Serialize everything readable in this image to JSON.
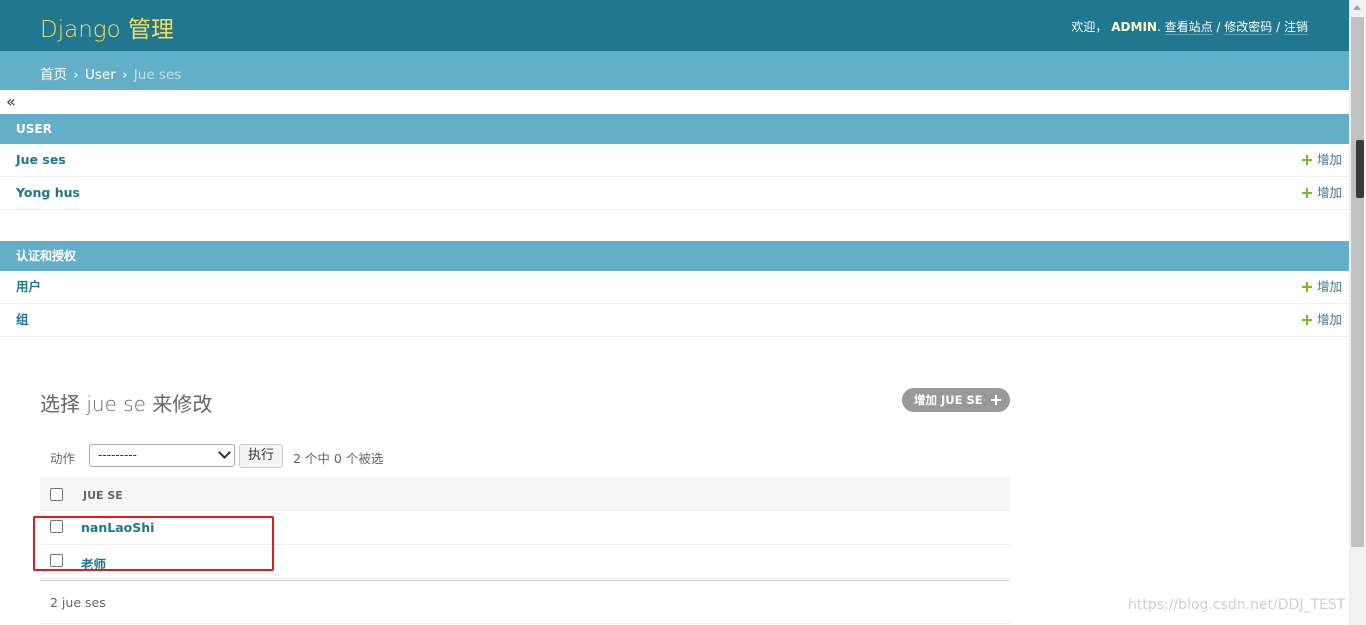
{
  "header": {
    "brand": "Django 管理",
    "welcome": "欢迎，",
    "username": "ADMIN",
    "view_site": "查看站点",
    "change_password": "修改密码",
    "logout": "注销",
    "sep": " / "
  },
  "breadcrumbs": {
    "home": "首页",
    "app": "User",
    "current": "Jue ses",
    "sep": "›"
  },
  "sidebar_toggle": "«",
  "apps": [
    {
      "caption": "USER",
      "models": [
        {
          "name": "Jue ses",
          "add": "增加"
        },
        {
          "name": "Yong hus",
          "add": "增加"
        }
      ]
    },
    {
      "caption": "认证和授权",
      "models": [
        {
          "name": "用户",
          "add": "增加"
        },
        {
          "name": "组",
          "add": "增加"
        }
      ]
    }
  ],
  "content": {
    "title": "选择 jue se 来修改",
    "add_button": "增加 JUE SE",
    "actions_label": "动作",
    "action_selected": "---------",
    "go_button": "执行",
    "counter": "2 个中 0 个被选",
    "column_header": "JUE SE",
    "rows": [
      "nanLaoShi",
      "老师"
    ],
    "paginator": "2 jue ses"
  },
  "watermark": "https://blog.csdn.net/DDJ_TEST",
  "colors": {
    "header_bg": "#217690",
    "brand": "#f5dd5d",
    "breadcrumbs_bg": "#63afc8",
    "caption_bg": "#63afc8",
    "link": "#217690",
    "add_icon": "#70bf2b",
    "highlight": "#e31b1b"
  }
}
